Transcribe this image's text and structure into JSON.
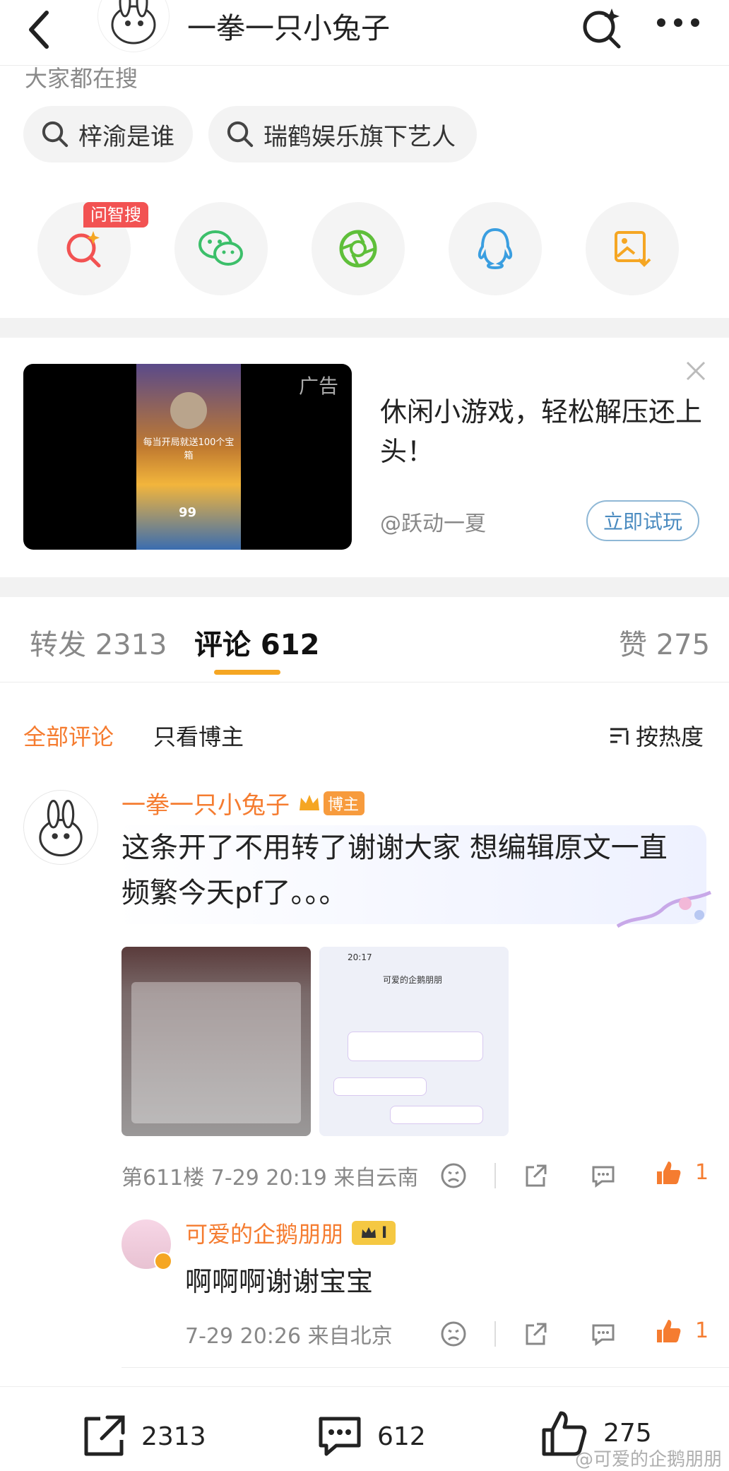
{
  "header": {
    "title": "一拳一只小兔子",
    "back_icon": "back-arrow-icon",
    "search_icon": "search-sparkle-icon",
    "more_icon": "more-dots-icon"
  },
  "search_section": {
    "hint": "大家都在搜",
    "chips": [
      {
        "label": "梓渝是谁"
      },
      {
        "label": "瑞鹤娱乐旗下艺人"
      }
    ]
  },
  "share": {
    "ai_badge": "问智搜",
    "items": [
      "ai-search-icon",
      "wechat-icon",
      "moments-icon",
      "qq-icon",
      "save-image-icon"
    ]
  },
  "ad": {
    "tag": "广告",
    "text": "休闲小游戏，轻松解压还上头！",
    "source": "@跃动一夏",
    "button": "立即试玩",
    "close_icon": "close-icon",
    "video_caption": "每当开局就送100个宝箱",
    "video_number": "99"
  },
  "tabs": [
    {
      "label": "转发 2313"
    },
    {
      "label": "评论 612"
    },
    {
      "label": "赞 275"
    }
  ],
  "filters": {
    "all": "全部评论",
    "blogger_only": "只看博主",
    "sort": "按热度"
  },
  "comment": {
    "user": "一拳一只小兔子",
    "badge": "博主",
    "text_line1": "这条开了不用转了谢谢大家 想编辑原文一直",
    "text_line2": "频繁今天pf了。。。",
    "meta": "第611楼 7-29 20:19 来自云南",
    "likes": "1",
    "image2_title": "可爱的企鹅朋朋",
    "image2_time": "20:17"
  },
  "reply": {
    "user": "可爱的企鹅朋朋",
    "level": "I",
    "text": "啊啊啊谢谢宝宝",
    "meta": "7-29 20:26 来自北京",
    "likes": "1"
  },
  "bottom_bar": {
    "repost": "2313",
    "comment": "612",
    "like": "275"
  },
  "watermark": "@可爱的企鹅朋朋",
  "colors": {
    "accent_orange": "#f57c30",
    "tab_underline": "#f5a623",
    "ad_button_border": "#8fb8d6",
    "ai_badge": "#f25252"
  }
}
